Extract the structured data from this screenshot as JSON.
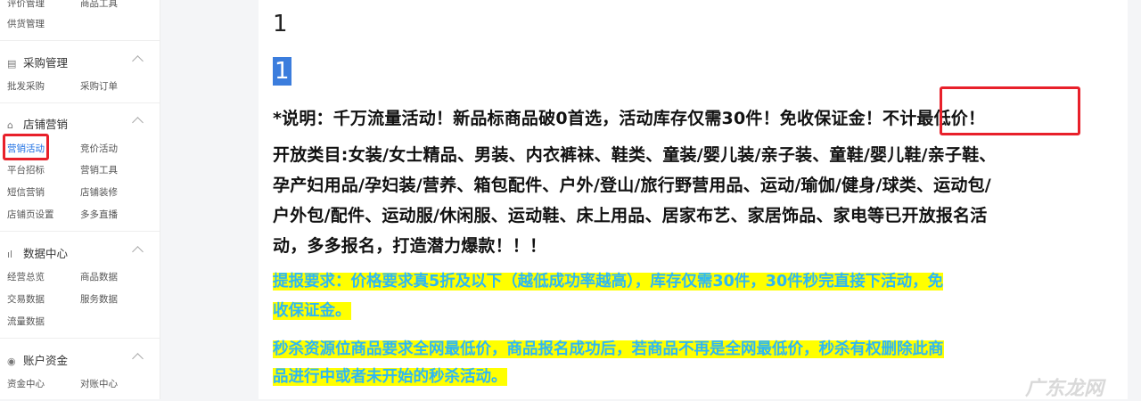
{
  "sidebar": {
    "top_row": {
      "left": "评价管理",
      "right": "商品工具"
    },
    "row_supply": "供货管理",
    "sections": [
      {
        "title": "采购管理",
        "icon": "clipboard-icon",
        "rows": [
          {
            "left": "批发采购",
            "right": "采购订单"
          }
        ]
      },
      {
        "title": "店铺营销",
        "icon": "store-icon",
        "rows": [
          {
            "left": "营销活动",
            "right": "竞价活动"
          },
          {
            "left": "平台招标",
            "right": "营销工具"
          },
          {
            "left": "短信营销",
            "right": "店铺装修"
          },
          {
            "left": "店铺页设置",
            "right": "多多直播"
          }
        ]
      },
      {
        "title": "数据中心",
        "icon": "bar-chart-icon",
        "rows": [
          {
            "left": "经营总览",
            "right": "商品数据"
          },
          {
            "left": "交易数据",
            "right": "服务数据"
          },
          {
            "left": "流量数据",
            "right": ""
          }
        ]
      },
      {
        "title": "账户资金",
        "icon": "coin-icon",
        "rows": [
          {
            "left": "资金中心",
            "right": "对账中心"
          }
        ]
      }
    ],
    "active_item": "营销活动",
    "icons": {
      "section_icon_1": "▤",
      "section_icon_2": "⌂",
      "section_icon_3": "ıl",
      "section_icon_4": "◉"
    }
  },
  "content": {
    "line1": "1",
    "line2_selected": "1",
    "desc_main": "*说明：千万流量活动！新品标商品破0首选，活动库存仅需30件！免收保证金！",
    "desc_highlight": "不计最低价！",
    "categories": [
      "开放类目:女装/女士精品、男装、内衣裤袜、鞋类、童装/婴儿装/亲子装、童鞋/婴儿鞋/亲子鞋、",
      "孕产妇用品/孕妇装/营养、箱包配件、户外/登山/旅行野营用品、运动/瑜伽/健身/球类、运动包/",
      "户外包/配件、运动服/休闲服、运动鞋、床上用品、居家布艺、家居饰品、家电等已开放报名活",
      "动，多多报名，打造潜力爆款！！！"
    ],
    "requirement": [
      "提报要求：价格要求真5折及以下（越低成功率越高），库存仅需30件，30件秒完直接下活动，免",
      "收保证金。"
    ],
    "seckill": [
      "秒杀资源位商品要求全网最低价，商品报名成功后，若商品不再是全网最低价，秒杀有权删除此商",
      "品进行中或者未开始的秒杀活动。"
    ]
  },
  "watermark": "广东龙网",
  "colors": {
    "highlight_bg": "#ffff00",
    "highlight_text": "#2db7f5",
    "annotation_red": "#e8202a",
    "active_link": "#1d6fe3"
  }
}
